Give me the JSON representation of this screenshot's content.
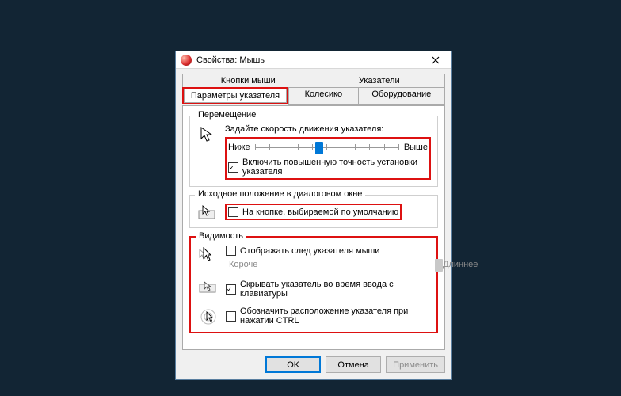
{
  "window": {
    "title": "Свойства: Мышь"
  },
  "tabs": {
    "row1": [
      "Кнопки мыши",
      "Указатели"
    ],
    "row2": [
      "Параметры указателя",
      "Колесико",
      "Оборудование"
    ],
    "active": "Параметры указателя"
  },
  "groups": {
    "movement": {
      "title": "Перемещение",
      "speed_label": "Задайте скорость движения указателя:",
      "slow": "Ниже",
      "fast": "Выше",
      "slider_pos": 0.42,
      "enhance_precision": {
        "checked": true,
        "label": "Включить повышенную точность установки указателя"
      }
    },
    "snap": {
      "title": "Исходное положение в диалоговом окне",
      "default_button": {
        "checked": false,
        "label": "На кнопке, выбираемой по умолчанию"
      }
    },
    "visibility": {
      "title": "Видимость",
      "trail": {
        "checked": false,
        "label": "Отображать след указателя мыши"
      },
      "trail_short": "Короче",
      "trail_long": "Длиннее",
      "hide_typing": {
        "checked": true,
        "label": "Скрывать указатель во время ввода с клавиатуры"
      },
      "ctrl_locate": {
        "checked": false,
        "label": "Обозначить расположение указателя при нажатии CTRL"
      }
    }
  },
  "buttons": {
    "ok": "OK",
    "cancel": "Отмена",
    "apply": "Применить"
  }
}
